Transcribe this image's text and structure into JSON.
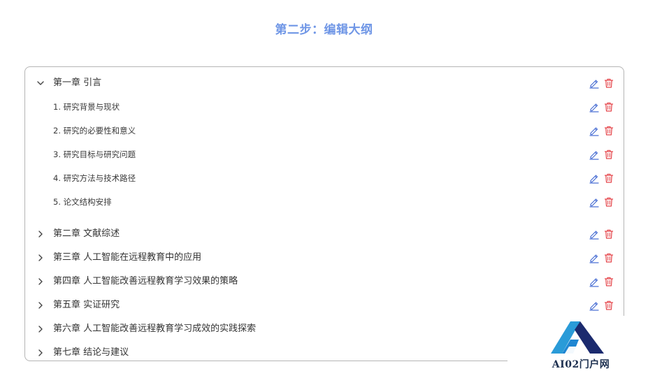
{
  "page": {
    "title": "第二步：编辑大纲"
  },
  "outline": {
    "chapters": [
      {
        "label": "第一章 引言",
        "expanded": true,
        "sections": [
          "1. 研究背景与现状",
          "2. 研究的必要性和意义",
          "3. 研究目标与研究问题",
          "4. 研究方法与技术路径",
          "5. 论文结构安排"
        ]
      },
      {
        "label": "第二章 文献综述",
        "expanded": false,
        "sections": []
      },
      {
        "label": "第三章 人工智能在远程教育中的应用",
        "expanded": false,
        "sections": []
      },
      {
        "label": "第四章 人工智能改善远程教育学习效果的策略",
        "expanded": false,
        "sections": []
      },
      {
        "label": "第五章 实证研究",
        "expanded": false,
        "sections": []
      },
      {
        "label": "第六章 人工智能改善远程教育学习成效的实践探索",
        "expanded": false,
        "sections": []
      },
      {
        "label": "第七章 结论与建议",
        "expanded": false,
        "sections": []
      }
    ]
  },
  "icons": {
    "expanded": "chevron-down-icon",
    "collapsed": "chevron-right-icon",
    "edit": "pencil-icon",
    "delete": "trash-icon"
  },
  "colors": {
    "title": "#6f96e6",
    "edit_icon": "#4a6fd4",
    "delete_icon": "#e5484d",
    "border": "#b5b5b5"
  },
  "watermark": {
    "text": "AI02门户网"
  }
}
